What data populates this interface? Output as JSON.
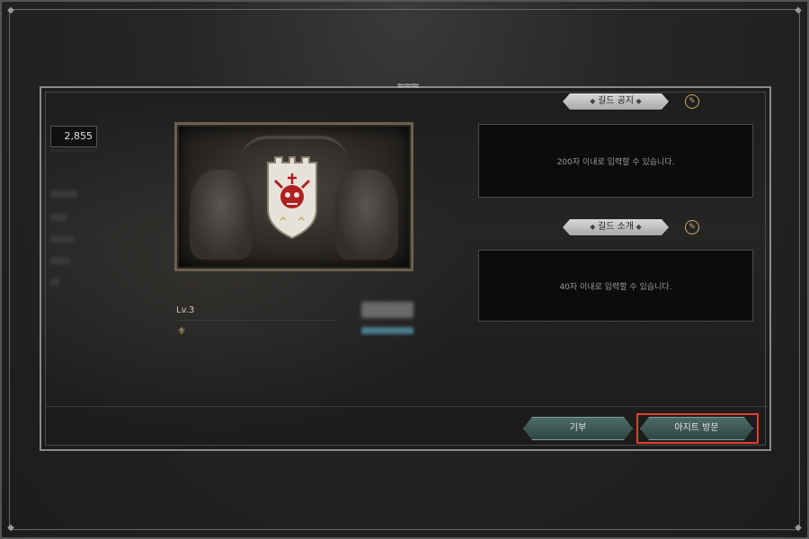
{
  "left_panel": {
    "stat_value": "2,855"
  },
  "guild": {
    "level_label": "Lv.3"
  },
  "notice": {
    "title": "길드 공지",
    "placeholder": "200자 이내로 입력할 수 있습니다."
  },
  "intro": {
    "title": "길드 소개",
    "placeholder": "40자 이내로 입력할 수 있습니다."
  },
  "buttons": {
    "donate": "기부",
    "visit_hideout": "아지트 방문"
  },
  "icons": {
    "edit": "pencil-icon",
    "rank": "rank-crest-icon",
    "corner": "diamond-corner-icon"
  },
  "colors": {
    "button_teal": "#3e5a56",
    "highlight_red": "#e0412d",
    "shield_red": "#b02020"
  }
}
